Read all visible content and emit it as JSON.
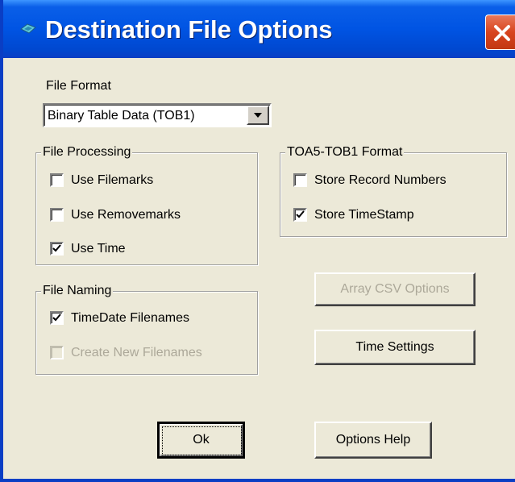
{
  "window": {
    "title": "Destination File Options",
    "icons": {
      "app": "app-icon",
      "close": "close-icon"
    }
  },
  "file_format": {
    "label": "File Format",
    "selected": "Binary Table Data (TOB1)"
  },
  "file_processing": {
    "title": "File Processing",
    "items": [
      {
        "label": "Use Filemarks",
        "checked": false,
        "enabled": true
      },
      {
        "label": "Use Removemarks",
        "checked": false,
        "enabled": true
      },
      {
        "label": "Use Time",
        "checked": true,
        "enabled": true
      }
    ]
  },
  "toa5_tob1": {
    "title": "TOA5-TOB1 Format",
    "items": [
      {
        "label": "Store Record Numbers",
        "checked": false,
        "enabled": true
      },
      {
        "label": "Store TimeStamp",
        "checked": true,
        "enabled": true
      }
    ]
  },
  "file_naming": {
    "title": "File Naming",
    "items": [
      {
        "label": "TimeDate Filenames",
        "checked": true,
        "enabled": true
      },
      {
        "label": "Create New Filenames",
        "checked": false,
        "enabled": false
      }
    ]
  },
  "buttons": {
    "array_csv": "Array CSV Options",
    "time_settings": "Time Settings",
    "ok": "Ok",
    "options_help": "Options Help"
  },
  "colors": {
    "titlebar": "#0054E3",
    "dialog_face": "#ECE9D8",
    "close_button": "#D8441E",
    "disabled_text": "#ACA899"
  }
}
